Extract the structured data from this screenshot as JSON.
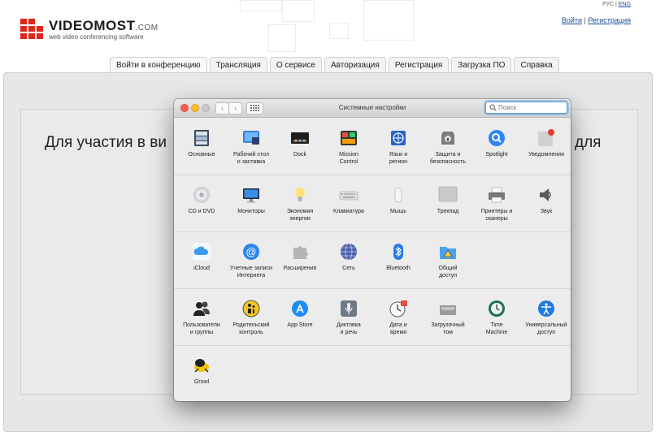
{
  "site": {
    "logo_name": "VIDEOMOST",
    "logo_domain": ".COM",
    "tagline": "web video conferencing software",
    "lang_ru": "РУС",
    "lang_sep": "|",
    "lang_en": "ENG",
    "login": "Войти",
    "auth_sep": "|",
    "register": "Регистрация",
    "tabs": [
      "Войти в конференцию",
      "Трансляция",
      "О сервисе",
      "Авторизация",
      "Регистрация",
      "Загрузка ПО",
      "Справка"
    ],
    "headline_left": "Для участия в ви",
    "headline_right": "для"
  },
  "window": {
    "title": "Системные настройки",
    "search_placeholder": "Поиск",
    "traffic_colors": [
      "#fc5f57",
      "#fdbc2e",
      "#c9c9c9"
    ],
    "sections": [
      [
        {
          "label": "Основные",
          "icon": "general-icon"
        },
        {
          "label": "Рабочий стол\nи заставка",
          "icon": "desktop-icon"
        },
        {
          "label": "Dock",
          "icon": "dock-icon"
        },
        {
          "label": "Mission\nControl",
          "icon": "mission-control-icon"
        },
        {
          "label": "Язык и\nрегион",
          "icon": "language-icon"
        },
        {
          "label": "Защита и\nбезопасность",
          "icon": "security-icon"
        },
        {
          "label": "Spotlight",
          "icon": "spotlight-icon"
        },
        {
          "label": "Уведомления",
          "icon": "notifications-icon"
        }
      ],
      [
        {
          "label": "CD и DVD",
          "icon": "cd-icon"
        },
        {
          "label": "Мониторы",
          "icon": "monitor-icon"
        },
        {
          "label": "Экономия\nэнергии",
          "icon": "energy-icon"
        },
        {
          "label": "Клавиатура",
          "icon": "keyboard-icon"
        },
        {
          "label": "Мышь",
          "icon": "mouse-icon"
        },
        {
          "label": "Трекпад",
          "icon": "trackpad-icon"
        },
        {
          "label": "Принтеры и\nсканеры",
          "icon": "printer-icon"
        },
        {
          "label": "Звук",
          "icon": "sound-icon"
        }
      ],
      [
        {
          "label": "iCloud",
          "icon": "icloud-icon"
        },
        {
          "label": "Учетные записи\nИнтернета",
          "icon": "internet-accounts-icon"
        },
        {
          "label": "Расширения",
          "icon": "extensions-icon"
        },
        {
          "label": "Сеть",
          "icon": "network-icon"
        },
        {
          "label": "Bluetooth",
          "icon": "bluetooth-icon"
        },
        {
          "label": "Общий\nдоступ",
          "icon": "sharing-icon"
        }
      ],
      [
        {
          "label": "Пользователи\nи группы",
          "icon": "users-icon"
        },
        {
          "label": "Родительский\nконтроль",
          "icon": "parental-icon"
        },
        {
          "label": "App Store",
          "icon": "appstore-icon"
        },
        {
          "label": "Диктовка\nи речь",
          "icon": "dictation-icon"
        },
        {
          "label": "Дата и\nвремя",
          "icon": "datetime-icon"
        },
        {
          "label": "Загрузочный\nтом",
          "icon": "startup-disk-icon"
        },
        {
          "label": "Time\nMachine",
          "icon": "time-machine-icon"
        },
        {
          "label": "Универсальный\nдоступ",
          "icon": "accessibility-icon"
        }
      ],
      [
        {
          "label": "Growl",
          "icon": "growl-icon"
        }
      ]
    ]
  }
}
